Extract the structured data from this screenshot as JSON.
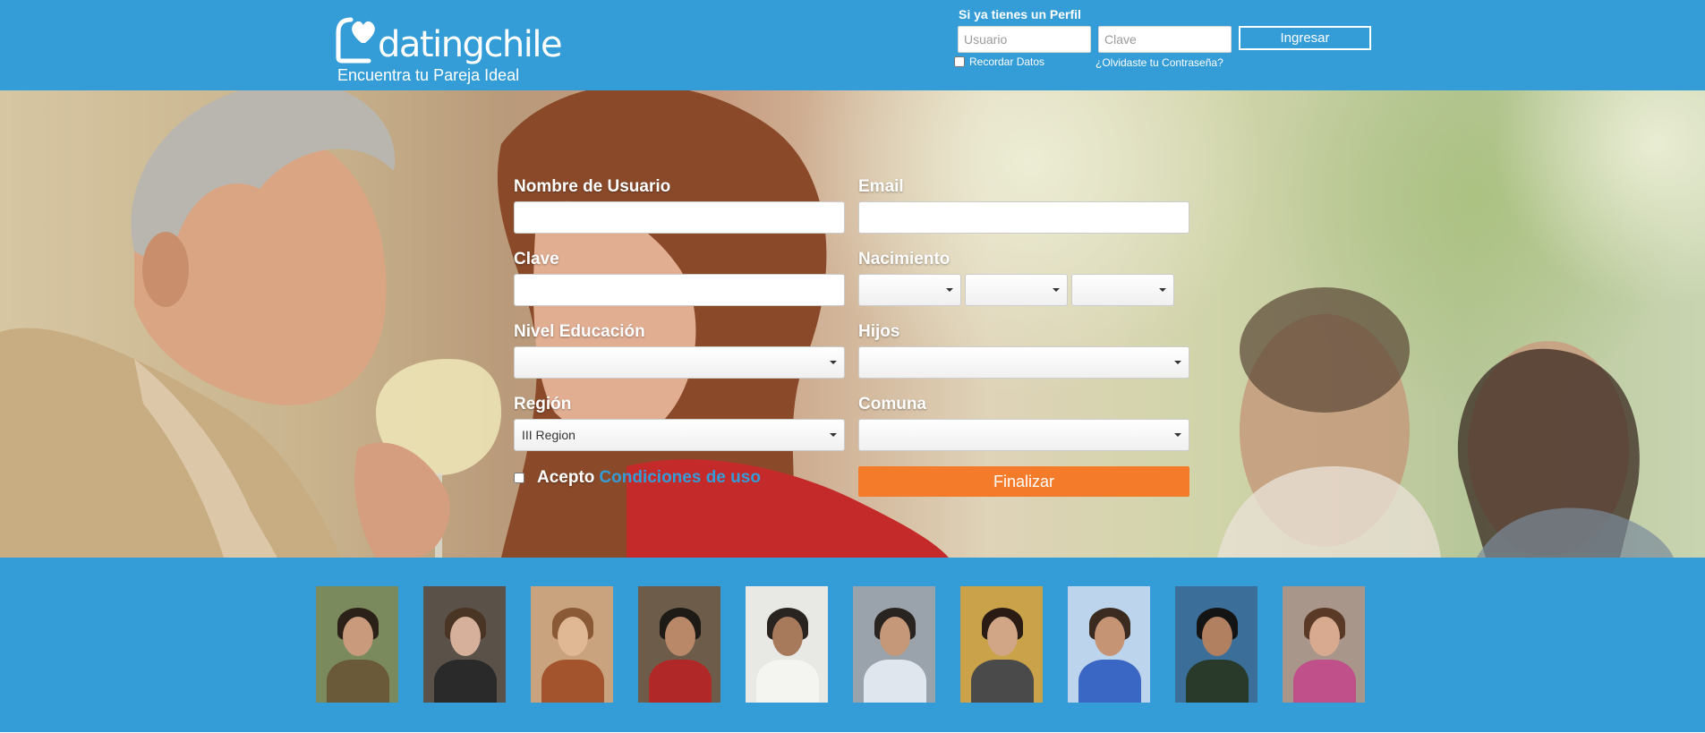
{
  "brand": {
    "name": "datingchile",
    "tagline": "Encuentra tu Pareja Ideal",
    "color": "#349cd6"
  },
  "login": {
    "title": "Si ya tienes un Perfil",
    "username_placeholder": "Usuario",
    "password_placeholder": "Clave",
    "submit_label": "Ingresar",
    "remember_label": "Recordar Datos",
    "forgot_label": "¿Olvidaste tu Contraseña?"
  },
  "signup": {
    "username_label": "Nombre de Usuario",
    "email_label": "Email",
    "password_label": "Clave",
    "birth_label": "Nacimiento",
    "education_label": "Nivel Educación",
    "children_label": "Hijos",
    "region_label": "Región",
    "region_value": "III Region",
    "commune_label": "Comuna",
    "accept_label": "Acepto",
    "terms_link": "Condiciones de uso",
    "submit_label": "Finalizar",
    "submit_color": "#f47b2a"
  },
  "profiles": [
    {
      "name": "profile-photo-1",
      "bg": "#7b8a5c",
      "hair": "#2b2118",
      "skin": "#c99a7c",
      "body": "#6b5a3a"
    },
    {
      "name": "profile-photo-2",
      "bg": "#5a5148",
      "hair": "#4a3424",
      "skin": "#d6b09a",
      "body": "#2a2a2a"
    },
    {
      "name": "profile-photo-3",
      "bg": "#c9a37e",
      "hair": "#8a5a36",
      "skin": "#e0b894",
      "body": "#a3542c"
    },
    {
      "name": "profile-photo-4",
      "bg": "#6e5c4a",
      "hair": "#1e1a16",
      "skin": "#b98868",
      "body": "#b02828"
    },
    {
      "name": "profile-photo-5",
      "bg": "#e8e8e4",
      "hair": "#2a2420",
      "skin": "#a87a5c",
      "body": "#f4f4f0"
    },
    {
      "name": "profile-photo-6",
      "bg": "#9aa2ac",
      "hair": "#2a2420",
      "skin": "#c49878",
      "body": "#dfe6ee"
    },
    {
      "name": "profile-photo-7",
      "bg": "#c9a24a",
      "hair": "#2a1c14",
      "skin": "#d0a686",
      "body": "#4a4a4a"
    },
    {
      "name": "profile-photo-8",
      "bg": "#bcd4ec",
      "hair": "#3a2a20",
      "skin": "#c49474",
      "body": "#3a66c4"
    },
    {
      "name": "profile-photo-9",
      "bg": "#3c6e9a",
      "hair": "#141414",
      "skin": "#b08060",
      "body": "#2a3a2a"
    },
    {
      "name": "profile-photo-10",
      "bg": "#a8968a",
      "hair": "#5a3a26",
      "skin": "#d8aa90",
      "body": "#c0508a"
    }
  ]
}
